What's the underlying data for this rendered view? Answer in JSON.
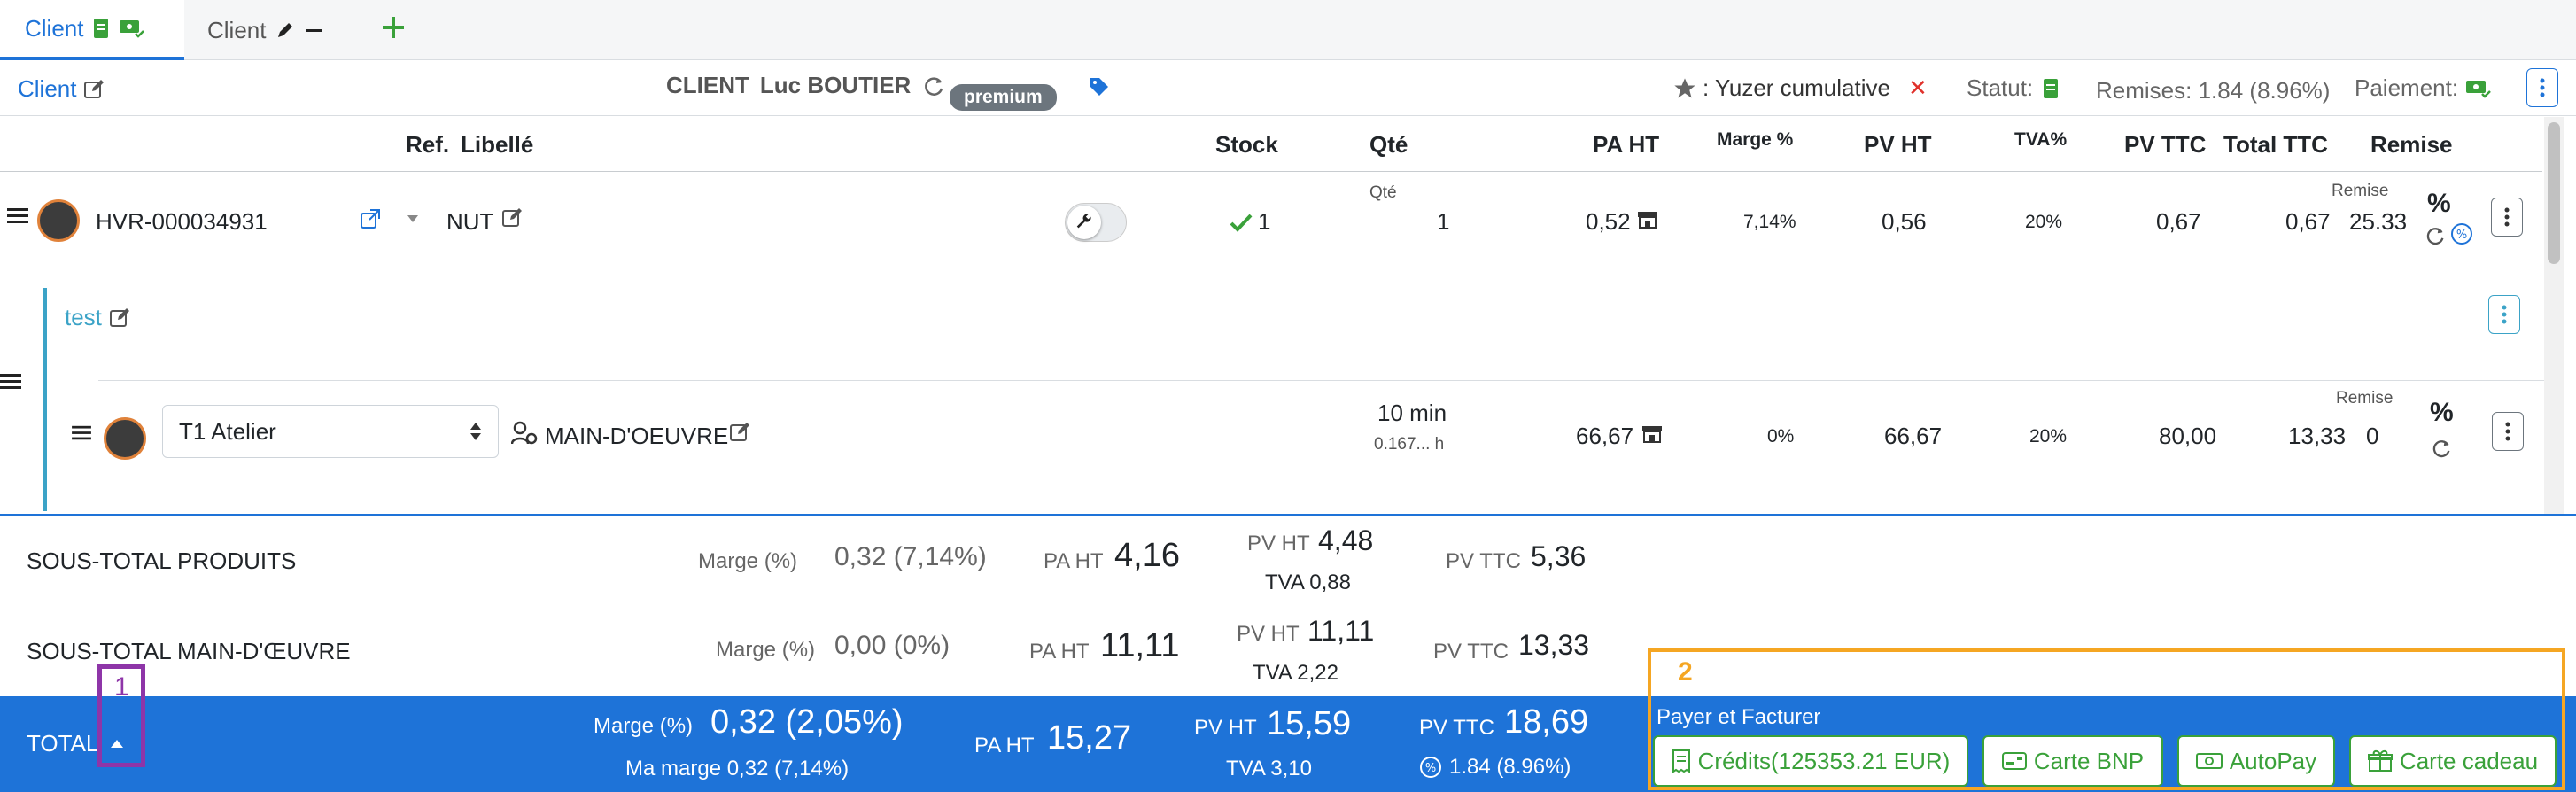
{
  "tabs": [
    {
      "label": "Client",
      "active": true
    },
    {
      "label": "Client",
      "active": false
    }
  ],
  "client_bar": {
    "client_link": "Client",
    "client_prefix": "CLIENT",
    "client_name": "Luc BOUTIER",
    "premium_badge": "premium",
    "yuzer_label": ": Yuzer cumulative",
    "statut_label": "Statut:",
    "remises_label": "Remises: 1.84 (8.96%)",
    "paiement_label": "Paiement:"
  },
  "table_header": {
    "ref": "Ref.",
    "libelle": "Libellé",
    "stock": "Stock",
    "qte": "Qté",
    "pa_ht": "PA HT",
    "marge": "Marge %",
    "pv_ht": "PV HT",
    "tva": "TVA%",
    "pv_ttc": "PV TTC",
    "total_ttc": "Total TTC",
    "remise": "Remise"
  },
  "product_row": {
    "ref": "HVR-000034931",
    "libelle": "NUT",
    "stock": "1",
    "qte_label": "Qté",
    "qte": "1",
    "pa_ht": "0,52",
    "marge": "7,14%",
    "pv_ht": "0,56",
    "tva": "20%",
    "pv_ttc": "0,67",
    "total_ttc": "0,67",
    "remise_label": "Remise",
    "remise": "25.33",
    "percent": "%"
  },
  "group": {
    "name": "test"
  },
  "labour_row": {
    "select_value": "T1 Atelier",
    "libelle": "MAIN-D'OEUVRE",
    "qte": "10 min",
    "qte_hours": "0.167... h",
    "pa_ht": "66,67",
    "marge": "0%",
    "pv_ht": "66,67",
    "tva": "20%",
    "pv_ttc": "80,00",
    "total_ttc": "13,33",
    "remise_label": "Remise",
    "remise": "0",
    "percent": "%"
  },
  "subtotal_products": {
    "label": "SOUS-TOTAL PRODUITS",
    "marge_label": "Marge (%)",
    "marge_value": "0,32 (7,14%)",
    "pa_label": "PA HT",
    "pa_value": "4,16",
    "pv_label": "PV HT",
    "pv_value": "4,48",
    "tva": "TVA 0,88",
    "pvttc_label": "PV TTC",
    "pvttc_value": "5,36"
  },
  "subtotal_labour": {
    "label": "SOUS-TOTAL MAIN-D'ŒUVRE",
    "marge_label": "Marge (%)",
    "marge_value": "0,00 (0%)",
    "pa_label": "PA HT",
    "pa_value": "11,11",
    "pv_label": "PV HT",
    "pv_value": "11,11",
    "tva": "TVA 2,22",
    "pvttc_label": "PV TTC",
    "pvttc_value": "13,33"
  },
  "total": {
    "label": "TOTAL",
    "marge_label": "Marge (%)",
    "marge_value": "0,32 (2,05%)",
    "ma_marge": "Ma marge 0,32 (7,14%)",
    "pa_label": "PA HT",
    "pa_value": "15,27",
    "pv_label": "PV HT",
    "pv_value": "15,59",
    "tva": "TVA 3,10",
    "pvttc_label": "PV TTC",
    "pvttc_value": "18,69",
    "discount": "1.84 (8.96%)"
  },
  "payment": {
    "title": "Payer et Facturer",
    "buttons": [
      "Crédits(125353.21 EUR)",
      "Carte BNP",
      "AutoPay",
      "Carte cadeau"
    ]
  },
  "annotations": {
    "one": "1",
    "two": "2"
  },
  "colors": {
    "accent": "#1e73d8",
    "success": "#3aa13a",
    "annotation_1": "#8e35a8",
    "annotation_2": "#f5a623"
  }
}
